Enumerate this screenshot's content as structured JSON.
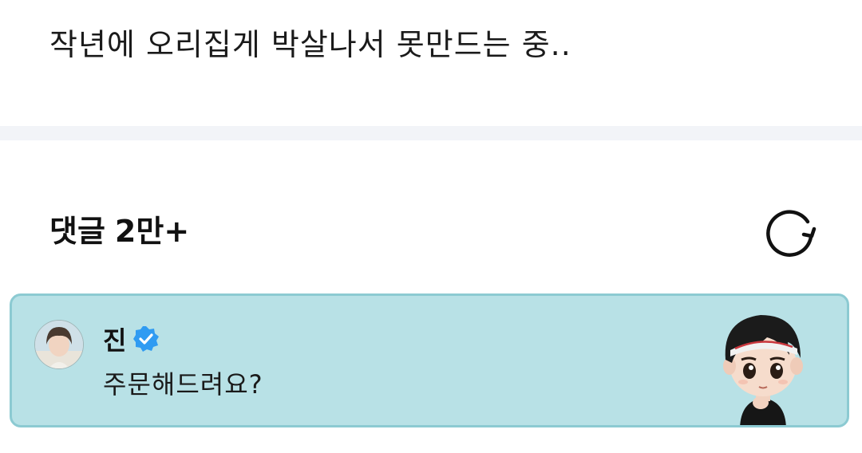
{
  "post": {
    "text": "작년에 오리집게 박살나서 못만드는 중.."
  },
  "comments": {
    "title": "댓글",
    "count": "2만+"
  },
  "pinned_comment": {
    "author": "진",
    "text": "주문해드려요?"
  },
  "icons": {
    "refresh": "refresh-icon",
    "verified": "verified-badge-icon",
    "avatar": "user-avatar",
    "sticker": "character-sticker"
  },
  "colors": {
    "card_background": "#b8e1e6",
    "card_border": "#8ccad2",
    "verified_blue": "#2f9bf2",
    "divider": "#f2f4f8"
  }
}
